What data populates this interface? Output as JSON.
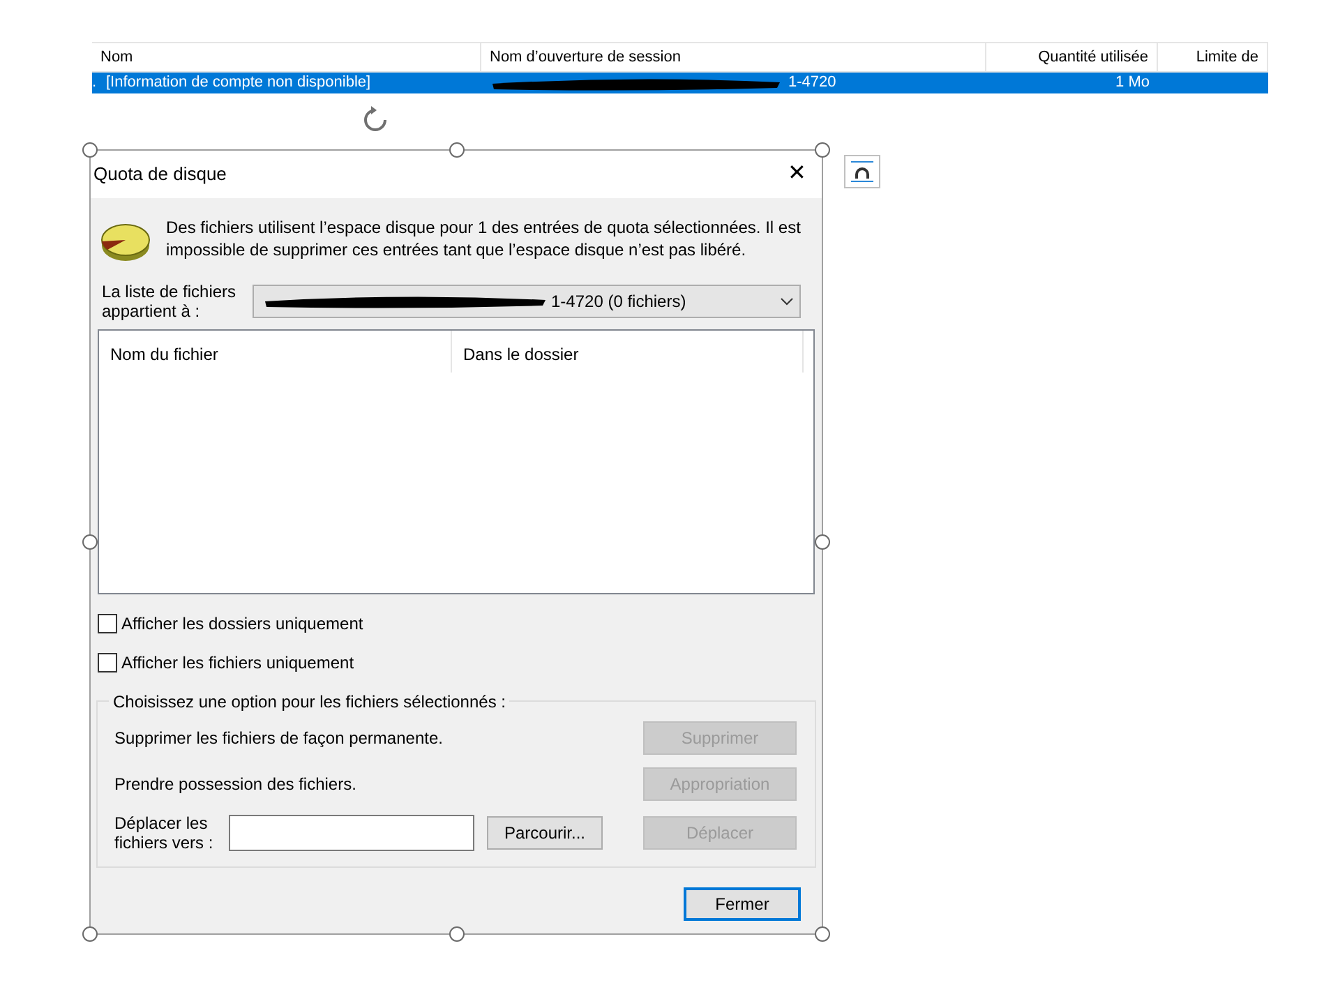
{
  "table": {
    "columns": [
      "Nom",
      "Nom d’ouverture de session",
      "Quantité utilisée",
      "Limite de"
    ],
    "rows": [
      {
        "selected": true,
        "marker": ".",
        "name": "[Information de compte non disponible]",
        "logon": "1-4720",
        "used": "1 Mo"
      }
    ]
  },
  "dialog": {
    "title": "Quota de disque",
    "close": "✕",
    "message": "Des fichiers utilisent l’espace disque pour 1 des entrées de quota sélectionnées. Il est impossible de supprimer ces entrées tant que l’espace disque n’est pas libéré.",
    "owner_label": "La liste de fichiers appartient à :",
    "owner_value": "1-4720 (0 fichiers)",
    "list_columns": [
      "Nom du fichier",
      "Dans le dossier"
    ],
    "checkboxes": [
      {
        "label": "Afficher les dossiers uniquement",
        "checked": false
      },
      {
        "label": "Afficher les fichiers uniquement",
        "checked": false
      }
    ],
    "group_title": "Choisissez une option pour les fichiers sélectionnés :",
    "actions": [
      {
        "label": "Supprimer les fichiers de façon permanente.",
        "button": "Supprimer",
        "disabled": true
      },
      {
        "label": "Prendre possession des fichiers.",
        "button": "Appropriation",
        "disabled": true
      }
    ],
    "move": {
      "label": "Déplacer les fichiers vers :",
      "browse": "Parcourir...",
      "button": "Déplacer",
      "disabled": true
    },
    "close_button": "Fermer"
  }
}
